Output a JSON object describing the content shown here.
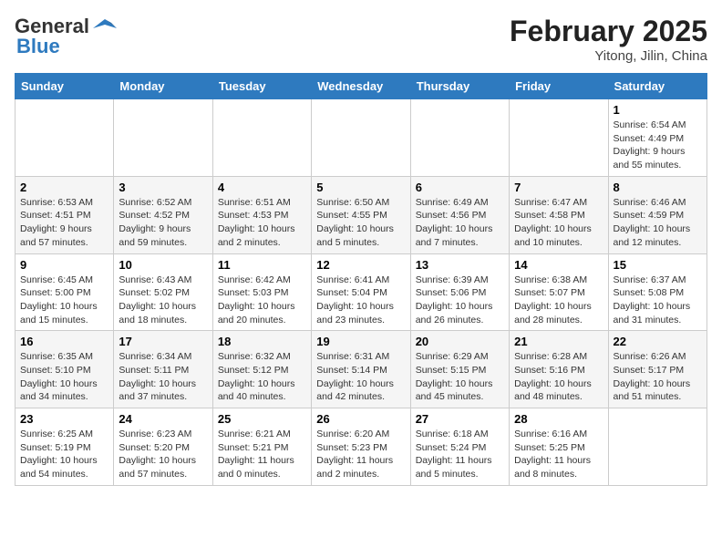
{
  "header": {
    "logo_line1": "General",
    "logo_line2": "Blue",
    "month_year": "February 2025",
    "location": "Yitong, Jilin, China"
  },
  "days_of_week": [
    "Sunday",
    "Monday",
    "Tuesday",
    "Wednesday",
    "Thursday",
    "Friday",
    "Saturday"
  ],
  "weeks": [
    [
      {
        "day": "",
        "info": ""
      },
      {
        "day": "",
        "info": ""
      },
      {
        "day": "",
        "info": ""
      },
      {
        "day": "",
        "info": ""
      },
      {
        "day": "",
        "info": ""
      },
      {
        "day": "",
        "info": ""
      },
      {
        "day": "1",
        "info": "Sunrise: 6:54 AM\nSunset: 4:49 PM\nDaylight: 9 hours and 55 minutes."
      }
    ],
    [
      {
        "day": "2",
        "info": "Sunrise: 6:53 AM\nSunset: 4:51 PM\nDaylight: 9 hours and 57 minutes."
      },
      {
        "day": "3",
        "info": "Sunrise: 6:52 AM\nSunset: 4:52 PM\nDaylight: 9 hours and 59 minutes."
      },
      {
        "day": "4",
        "info": "Sunrise: 6:51 AM\nSunset: 4:53 PM\nDaylight: 10 hours and 2 minutes."
      },
      {
        "day": "5",
        "info": "Sunrise: 6:50 AM\nSunset: 4:55 PM\nDaylight: 10 hours and 5 minutes."
      },
      {
        "day": "6",
        "info": "Sunrise: 6:49 AM\nSunset: 4:56 PM\nDaylight: 10 hours and 7 minutes."
      },
      {
        "day": "7",
        "info": "Sunrise: 6:47 AM\nSunset: 4:58 PM\nDaylight: 10 hours and 10 minutes."
      },
      {
        "day": "8",
        "info": "Sunrise: 6:46 AM\nSunset: 4:59 PM\nDaylight: 10 hours and 12 minutes."
      }
    ],
    [
      {
        "day": "9",
        "info": "Sunrise: 6:45 AM\nSunset: 5:00 PM\nDaylight: 10 hours and 15 minutes."
      },
      {
        "day": "10",
        "info": "Sunrise: 6:43 AM\nSunset: 5:02 PM\nDaylight: 10 hours and 18 minutes."
      },
      {
        "day": "11",
        "info": "Sunrise: 6:42 AM\nSunset: 5:03 PM\nDaylight: 10 hours and 20 minutes."
      },
      {
        "day": "12",
        "info": "Sunrise: 6:41 AM\nSunset: 5:04 PM\nDaylight: 10 hours and 23 minutes."
      },
      {
        "day": "13",
        "info": "Sunrise: 6:39 AM\nSunset: 5:06 PM\nDaylight: 10 hours and 26 minutes."
      },
      {
        "day": "14",
        "info": "Sunrise: 6:38 AM\nSunset: 5:07 PM\nDaylight: 10 hours and 28 minutes."
      },
      {
        "day": "15",
        "info": "Sunrise: 6:37 AM\nSunset: 5:08 PM\nDaylight: 10 hours and 31 minutes."
      }
    ],
    [
      {
        "day": "16",
        "info": "Sunrise: 6:35 AM\nSunset: 5:10 PM\nDaylight: 10 hours and 34 minutes."
      },
      {
        "day": "17",
        "info": "Sunrise: 6:34 AM\nSunset: 5:11 PM\nDaylight: 10 hours and 37 minutes."
      },
      {
        "day": "18",
        "info": "Sunrise: 6:32 AM\nSunset: 5:12 PM\nDaylight: 10 hours and 40 minutes."
      },
      {
        "day": "19",
        "info": "Sunrise: 6:31 AM\nSunset: 5:14 PM\nDaylight: 10 hours and 42 minutes."
      },
      {
        "day": "20",
        "info": "Sunrise: 6:29 AM\nSunset: 5:15 PM\nDaylight: 10 hours and 45 minutes."
      },
      {
        "day": "21",
        "info": "Sunrise: 6:28 AM\nSunset: 5:16 PM\nDaylight: 10 hours and 48 minutes."
      },
      {
        "day": "22",
        "info": "Sunrise: 6:26 AM\nSunset: 5:17 PM\nDaylight: 10 hours and 51 minutes."
      }
    ],
    [
      {
        "day": "23",
        "info": "Sunrise: 6:25 AM\nSunset: 5:19 PM\nDaylight: 10 hours and 54 minutes."
      },
      {
        "day": "24",
        "info": "Sunrise: 6:23 AM\nSunset: 5:20 PM\nDaylight: 10 hours and 57 minutes."
      },
      {
        "day": "25",
        "info": "Sunrise: 6:21 AM\nSunset: 5:21 PM\nDaylight: 11 hours and 0 minutes."
      },
      {
        "day": "26",
        "info": "Sunrise: 6:20 AM\nSunset: 5:23 PM\nDaylight: 11 hours and 2 minutes."
      },
      {
        "day": "27",
        "info": "Sunrise: 6:18 AM\nSunset: 5:24 PM\nDaylight: 11 hours and 5 minutes."
      },
      {
        "day": "28",
        "info": "Sunrise: 6:16 AM\nSunset: 5:25 PM\nDaylight: 11 hours and 8 minutes."
      },
      {
        "day": "",
        "info": ""
      }
    ]
  ]
}
